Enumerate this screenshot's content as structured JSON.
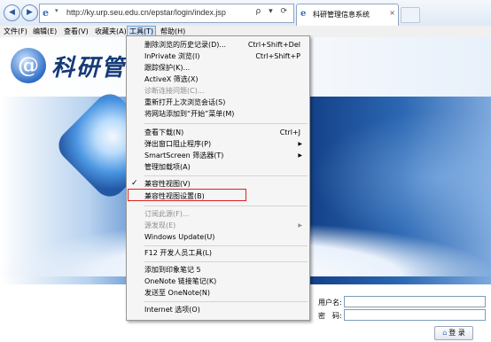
{
  "browser": {
    "url": "http://ky.urp.seu.edu.cn/epstar/login/index.jsp",
    "tab_title": "科研管理信息系统",
    "tab_close": "×",
    "addr_tools": "ρ ▾ ⟳",
    "back": "◀",
    "forward": "▶",
    "ie_glyph": "e",
    "dropdown_glyph": "▾"
  },
  "menubar": {
    "items": [
      "文件(F)",
      "编辑(E)",
      "查看(V)",
      "收藏夹(A)",
      "工具(T)",
      "帮助(H)"
    ],
    "active": "工具(T)"
  },
  "page": {
    "logo_text": "科研管理信",
    "logo_glyph": "@",
    "username_label": "用户名:",
    "password_label": "密　码:",
    "login_button": "登 录",
    "login_icon": "⌂"
  },
  "tools_menu": {
    "items": [
      {
        "label": "删除浏览的历史记录(D)...",
        "shortcut": "Ctrl+Shift+Del"
      },
      {
        "label": "InPrivate 浏览(I)",
        "shortcut": "Ctrl+Shift+P"
      },
      {
        "label": "跟踪保护(K)..."
      },
      {
        "label": "ActiveX 筛选(X)"
      },
      {
        "label": "诊断连接问题(C)...",
        "disabled": true
      },
      {
        "label": "重新打开上次浏览会话(S)"
      },
      {
        "label": "将网站添加到“开始”菜单(M)"
      },
      {
        "label": "查看下载(N)",
        "shortcut": "Ctrl+J"
      },
      {
        "label": "弹出窗口阻止程序(P)",
        "submenu": true
      },
      {
        "label": "SmartScreen 筛选器(T)",
        "submenu": true
      },
      {
        "label": "管理加载项(A)"
      },
      {
        "label": "兼容性视图(V)",
        "checked": true
      },
      {
        "label": "兼容性视图设置(B)",
        "highlighted": true
      },
      {
        "label": "订阅此源(F)...",
        "disabled": true
      },
      {
        "label": "源发现(E)",
        "disabled": true,
        "submenu": true
      },
      {
        "label": "Windows Update(U)"
      },
      {
        "label": "F12 开发人员工具(L)"
      },
      {
        "label": "添加到印象笔记 5"
      },
      {
        "label": "OneNote 链接笔记(K)"
      },
      {
        "label": "发送至 OneNote(N)"
      },
      {
        "label": "Internet 选项(O)"
      }
    ],
    "check_glyph": "✓",
    "arrow_glyph": "▶"
  }
}
